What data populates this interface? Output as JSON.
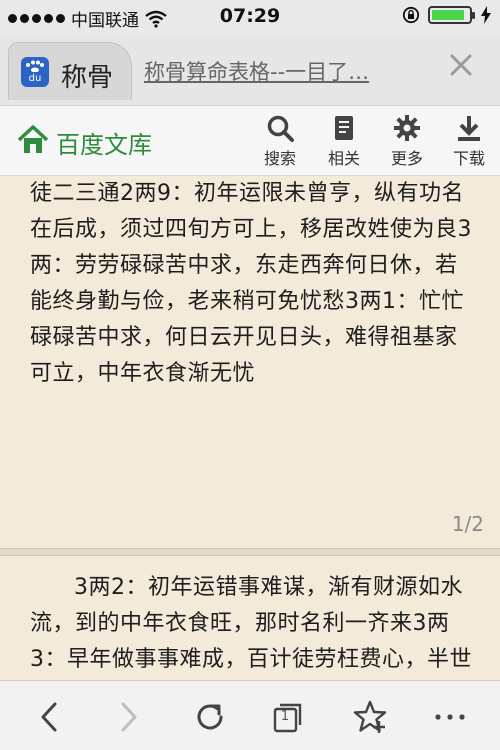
{
  "status_bar": {
    "carrier": "中国联通",
    "time": "07:29"
  },
  "tab": {
    "title_short": "称骨",
    "title_full": "称骨算命表格--一目了…"
  },
  "app_bar": {
    "brand": "百度文库",
    "actions": [
      {
        "label": "搜索",
        "icon": "search-icon"
      },
      {
        "label": "相关",
        "icon": "related-doc-icon"
      },
      {
        "label": "更多",
        "icon": "gear-icon"
      },
      {
        "label": "下载",
        "icon": "download-icon"
      }
    ]
  },
  "document": {
    "page1_text": "徒二三通2两9：初年运限未曾亨，纵有功名在后成，须过四旬方可上，移居改姓使为良3两：劳劳碌碌苦中求，东走西奔何日休，若能终身勤与俭，老来稍可免忧愁3两1：忙忙碌碌苦中求，何日云开见日头，难得祖基家可立，中年衣食渐无忧",
    "page_indicator": "1/2",
    "page2_text": "3两2：初年运错事难谋，渐有财源如水流，到的中年衣食旺，那时名利一齐来3两3：早年做事事难成，百计徒劳枉费心，半世自如流水走，后"
  },
  "toolbar": {
    "tab_count": "1"
  },
  "colors": {
    "brand_green": "#2f8c3e",
    "page_bg": "#f4ead9"
  }
}
